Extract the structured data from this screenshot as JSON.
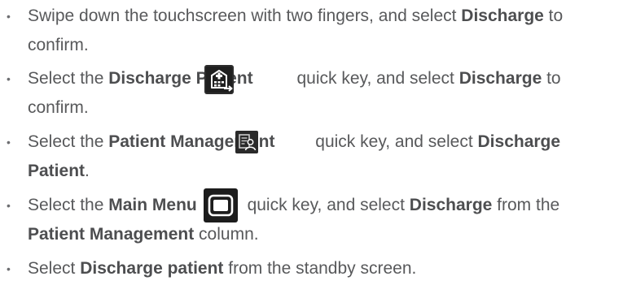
{
  "bullet_symbol": "•",
  "items": [
    {
      "line1": {
        "a": "Swipe down the touchscreen with two fingers, and select ",
        "b": "Discharge",
        "c": " to"
      },
      "line2": {
        "a": "confirm."
      }
    },
    {
      "line1": {
        "a": "Select the ",
        "b": "Discharge Patient",
        "c": " quick key, and select ",
        "d": "Discharge",
        "e": " to"
      },
      "line2": {
        "a": "confirm."
      },
      "icon": "discharge-patient-quick-key-icon"
    },
    {
      "line1": {
        "a": "Select the ",
        "b": "Patient Management",
        "c": " quick key, and select ",
        "d": "Discharge"
      },
      "line2": {
        "b": "Patient",
        "c": "."
      },
      "icon": "patient-management-quick-key-icon"
    },
    {
      "line1": {
        "a": "Select the ",
        "b": "Main Menu",
        "c": " quick key, and select ",
        "d": "Discharge",
        "e": " from the"
      },
      "line2": {
        "b": "Patient Management",
        "c": " column."
      },
      "icon": "main-menu-quick-key-icon"
    },
    {
      "line1": {
        "a": "Select ",
        "b": "Discharge patient",
        "c": " from the standby screen."
      }
    }
  ],
  "colors": {
    "text": "#58595b",
    "bold_text": "#4d4e50",
    "icon_background": "#1f1f1f",
    "icon_foreground": "#ffffff",
    "icon_accent": "#d6d6d6"
  }
}
